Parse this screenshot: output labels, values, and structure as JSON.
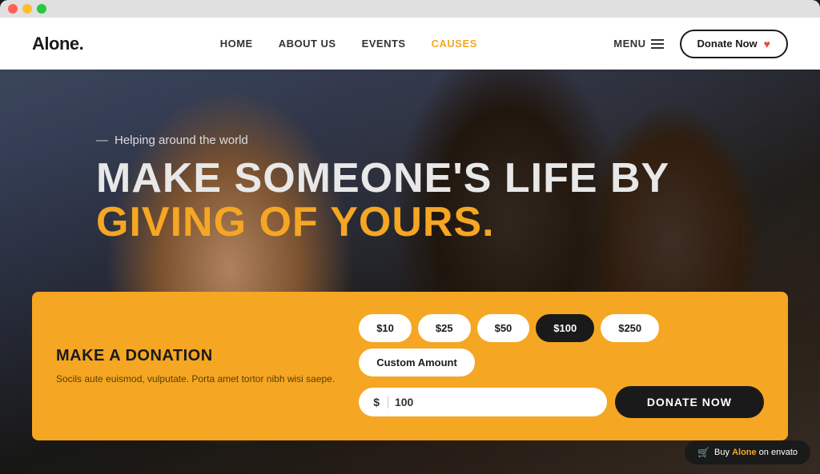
{
  "window": {
    "dots": [
      "red",
      "yellow",
      "green"
    ]
  },
  "navbar": {
    "logo": "Alone.",
    "links": [
      {
        "label": "HOME",
        "active": false
      },
      {
        "label": "ABOUT US",
        "active": false
      },
      {
        "label": "EVENTS",
        "active": false
      },
      {
        "label": "CAUSES",
        "active": true
      }
    ],
    "menu_label": "MENU",
    "donate_label": "Donate Now"
  },
  "hero": {
    "subtitle": "Helping around the world",
    "title_line1": "MAKE SOMEONE'S LIFE BY",
    "title_line2": "GIVING OF YOURS."
  },
  "donation_widget": {
    "title": "MAKE A DONATION",
    "description": "Socils aute euismod, vulputate. Porta amet tortor nibh wisi saepe.",
    "amounts": [
      {
        "label": "$10",
        "value": "10",
        "active": false
      },
      {
        "label": "$25",
        "value": "25",
        "active": false
      },
      {
        "label": "$50",
        "value": "50",
        "active": false
      },
      {
        "label": "$100",
        "value": "100",
        "active": true
      },
      {
        "label": "$250",
        "value": "250",
        "active": false
      },
      {
        "label": "Custom Amount",
        "value": "custom",
        "active": false
      }
    ],
    "input_prefix": "$",
    "input_value": "100",
    "button_label": "DONATE NOW"
  },
  "envato_badge": {
    "text_prefix": "Buy ",
    "brand": "Alone",
    "text_suffix": " on envato"
  }
}
